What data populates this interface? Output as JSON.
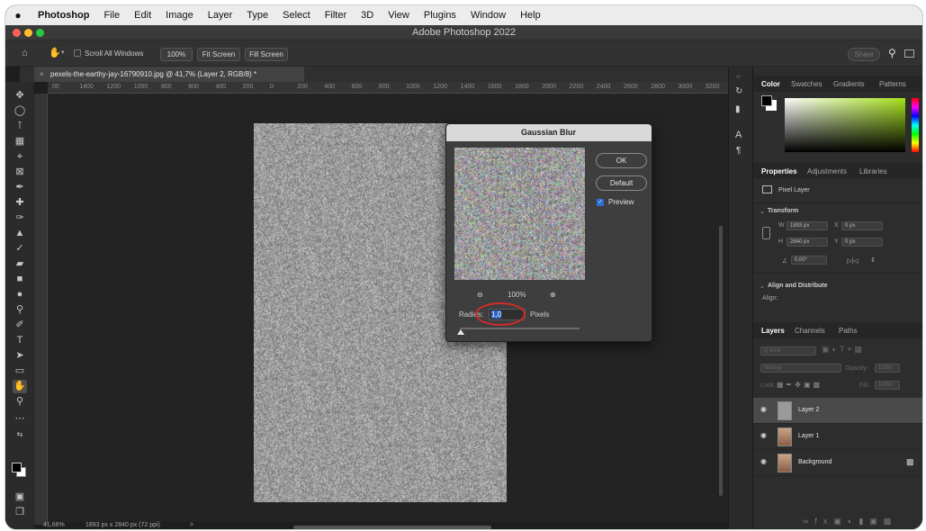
{
  "menubar": {
    "app_name": "Photoshop",
    "items": [
      "File",
      "Edit",
      "Image",
      "Layer",
      "Type",
      "Select",
      "Filter",
      "3D",
      "View",
      "Plugins",
      "Window",
      "Help"
    ]
  },
  "window": {
    "title": "Adobe Photoshop 2022"
  },
  "options_bar": {
    "scroll_all_windows": "Scroll All Windows",
    "zoom_100": "100%",
    "fit_screen": "Fit Screen",
    "fill_screen": "Fill Screen",
    "share": "Share"
  },
  "document_tab": {
    "label": "pexels-the-earthy-jay-16790910.jpg @ 41,7% (Layer 2, RGB/8) *"
  },
  "ruler": {
    "ticks": [
      "00",
      "1400",
      "1200",
      "1000",
      "800",
      "600",
      "400",
      "200",
      "0",
      "200",
      "400",
      "600",
      "800",
      "1000",
      "1200",
      "1400",
      "1600",
      "1800",
      "2000",
      "2200",
      "2400",
      "2600",
      "2800",
      "3000",
      "3200"
    ]
  },
  "status": {
    "zoom": "41,66%",
    "doc_info": "1893 px x 2840 px (72 ppi)",
    "arrow": ">"
  },
  "dialog": {
    "title": "Gaussian Blur",
    "ok": "OK",
    "default": "Default",
    "preview_label": "Preview",
    "preview_checked": true,
    "zoom_pct": "100%",
    "radius_label": "Radius:",
    "radius_value": "1,0",
    "radius_unit": "Pixels"
  },
  "color_panel": {
    "tabs": [
      "Color",
      "Swatches",
      "Gradients",
      "Patterns"
    ]
  },
  "properties_panel": {
    "tabs": [
      "Properties",
      "Adjustments",
      "Libraries"
    ],
    "layer_type": "Pixel Layer",
    "transform_header": "Transform",
    "w_label": "W",
    "w_value": "1893 px",
    "h_label": "H",
    "h_value": "2840 px",
    "x_label": "X",
    "x_value": "0 px",
    "y_label": "Y",
    "y_value": "0 px",
    "angle_value": "0,00°",
    "align_header": "Align and Distribute",
    "align_label": "Align:"
  },
  "layers_panel": {
    "tabs": [
      "Layers",
      "Channels",
      "Paths"
    ],
    "kind": "Q Kind",
    "blend_mode": "Normal",
    "opacity_label": "Opacity:",
    "opacity_value": "100%",
    "lock_label": "Lock:",
    "fill_label": "Fill:",
    "fill_value": "100%",
    "layers": [
      {
        "name": "Layer 2",
        "selected": true
      },
      {
        "name": "Layer 1",
        "selected": false
      },
      {
        "name": "Background",
        "selected": false
      }
    ]
  },
  "colors": {
    "accent_blue": "#2e63c4",
    "annotation_red": "#d22b2b",
    "traffic_close": "#fe5f57",
    "traffic_min": "#febc2e",
    "traffic_max": "#28c840"
  }
}
